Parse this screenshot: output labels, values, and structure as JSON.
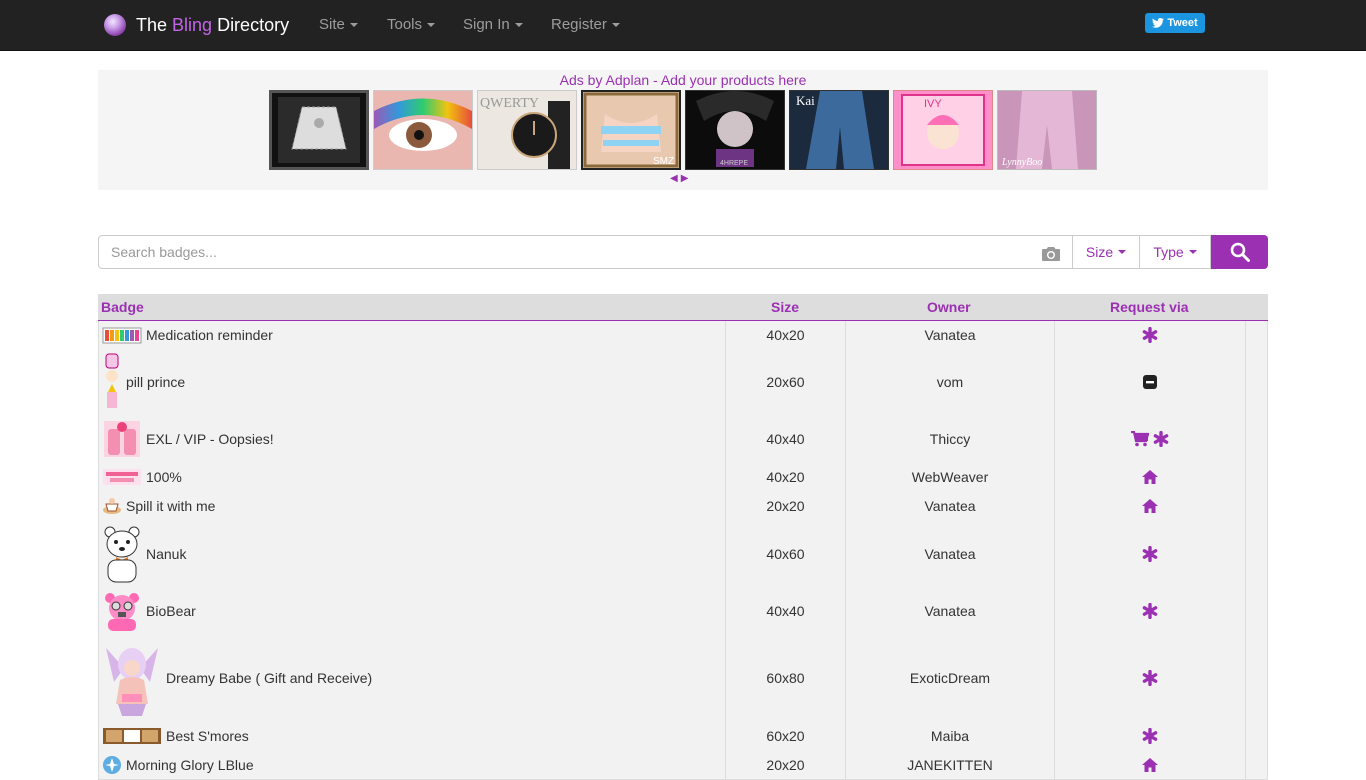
{
  "navbar": {
    "brand_pre": "The ",
    "brand_mid": "Bling",
    "brand_post": " Directory",
    "menu": [
      {
        "label": "Site"
      },
      {
        "label": "Tools"
      },
      {
        "label": "Sign In"
      },
      {
        "label": "Register"
      }
    ],
    "tweet_label": "Tweet"
  },
  "ads": {
    "title": "Ads by Adplan - Add your products here",
    "thumb_texts": [
      "QWERTY",
      "SMZ",
      "4HREPE",
      "Kai",
      "IVY",
      "LynnyBoo"
    ]
  },
  "search": {
    "placeholder": "Search badges...",
    "size_label": "Size",
    "type_label": "Type"
  },
  "table": {
    "headers": {
      "badge": "Badge",
      "size": "Size",
      "owner": "Owner",
      "request": "Request via"
    },
    "rows": [
      {
        "name": "Medication reminder",
        "size": "40x20",
        "owner": "Vanatea",
        "request": [
          "asterisk"
        ]
      },
      {
        "name": "pill prince",
        "size": "20x60",
        "owner": "vom",
        "request": [
          "minus-square"
        ]
      },
      {
        "name": "EXL / VIP - Oopsies!",
        "size": "40x40",
        "owner": "Thiccy",
        "request": [
          "cart",
          "asterisk"
        ]
      },
      {
        "name": "100%",
        "size": "40x20",
        "owner": "WebWeaver",
        "request": [
          "home"
        ]
      },
      {
        "name": "Spill it with me",
        "size": "20x20",
        "owner": "Vanatea",
        "request": [
          "home"
        ]
      },
      {
        "name": "Nanuk",
        "size": "40x60",
        "owner": "Vanatea",
        "request": [
          "asterisk"
        ]
      },
      {
        "name": "BioBear",
        "size": "40x40",
        "owner": "Vanatea",
        "request": [
          "asterisk"
        ]
      },
      {
        "name": "Dreamy Babe ( Gift and Receive)",
        "size": "60x80",
        "owner": "ExoticDream",
        "request": [
          "asterisk"
        ]
      },
      {
        "name": "Best S'mores",
        "size": "60x20",
        "owner": "Maiba",
        "request": [
          "asterisk"
        ]
      },
      {
        "name": "Morning Glory LBlue",
        "size": "20x20",
        "owner": "JANEKITTEN",
        "request": [
          "home"
        ]
      }
    ]
  },
  "colors": {
    "accent": "#9b30b3",
    "navbar": "#222222",
    "tweet": "#1b95e0"
  }
}
